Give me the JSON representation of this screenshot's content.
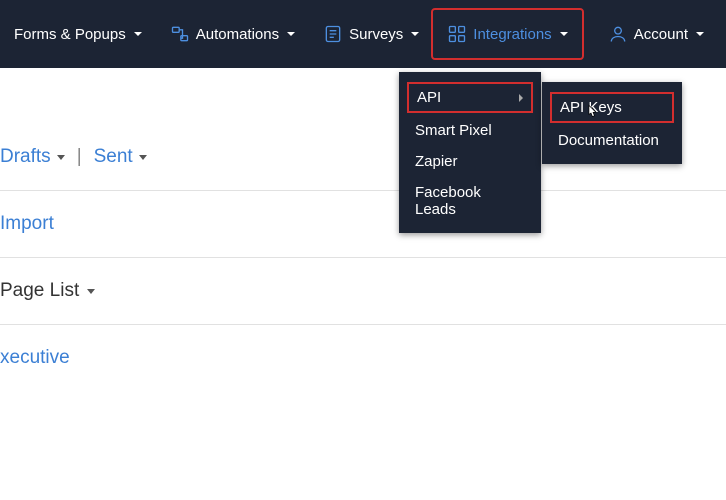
{
  "nav": {
    "forms": "Forms & Popups",
    "automations": "Automations",
    "surveys": "Surveys",
    "integrations": "Integrations",
    "account": "Account"
  },
  "integrations_menu": {
    "api": "API",
    "smart_pixel": "Smart Pixel",
    "zapier": "Zapier",
    "facebook_leads": "Facebook Leads"
  },
  "api_submenu": {
    "api_keys": "API Keys",
    "documentation": "Documentation"
  },
  "content": {
    "drafts": "Drafts",
    "sent": "Sent",
    "import": "Import",
    "page_list": "Page List",
    "cut_word": "xecutive"
  },
  "highlight_color": "#d22e2e"
}
